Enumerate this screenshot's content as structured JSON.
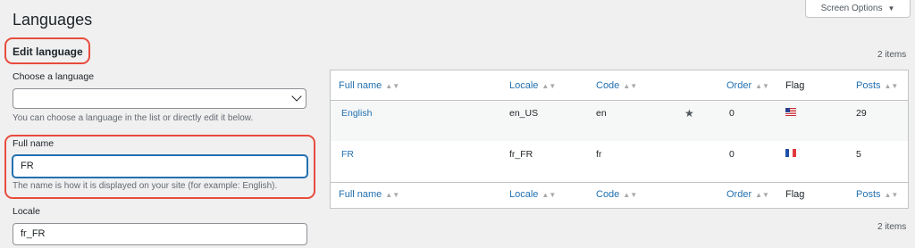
{
  "header": {
    "title": "Languages",
    "screen_options_label": "Screen Options"
  },
  "form": {
    "section_title": "Edit language",
    "choose_label": "Choose a language",
    "choose_value": "",
    "choose_hint": "You can choose a language in the list or directly edit it below.",
    "full_name_label": "Full name",
    "full_name_value": "FR",
    "full_name_hint": "The name is how it is displayed on your site (for example: English).",
    "locale_label": "Locale",
    "locale_value": "fr_FR"
  },
  "table": {
    "items_count": "2 items",
    "columns": [
      "Full name",
      "Locale",
      "Code",
      "Order",
      "Flag",
      "Posts"
    ],
    "rows": [
      {
        "full_name": "English",
        "locale": "en_US",
        "code": "en",
        "default": true,
        "order": "0",
        "flag": "us-flag-icon",
        "posts": "29"
      },
      {
        "full_name": "FR",
        "locale": "fr_FR",
        "code": "fr",
        "default": false,
        "order": "0",
        "flag": "fr-flag-icon",
        "posts": "5"
      }
    ]
  },
  "colors": {
    "link": "#2271b1",
    "highlight": "#e84c3d",
    "background": "#f0f0f1"
  }
}
